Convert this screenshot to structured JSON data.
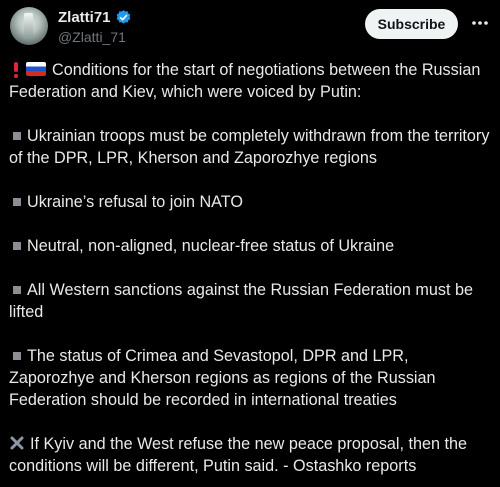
{
  "author": {
    "display_name": "Zlatti71",
    "handle": "@Zlatti_71"
  },
  "actions": {
    "subscribe_label": "Subscribe"
  },
  "post": {
    "intro": "Conditions for the start of negotiations between the Russian Federation and Kiev, which were voiced by Putin:",
    "conditions": [
      "Ukrainian troops must be completely withdrawn from the territory of the DPR, LPR, Kherson and Zaporozhye regions",
      "Ukraine’s refusal to join NATO",
      "Neutral, non-aligned, nuclear-free status of Ukraine",
      "All Western sanctions against the Russian Federation must be lifted",
      "The status of Crimea and Sevastopol, DPR and LPR, Zaporozhye and Kherson regions as regions of the Russian Federation should be recorded in international treaties"
    ],
    "closing": "If Kyiv and the West refuse the new peace proposal, then the conditions will be different, Putin said. - Ostashko reports"
  },
  "icons": {
    "verified": "verified-badge-icon",
    "more": "more-options-icon",
    "intro_marks": [
      "exclamation-icon",
      "russian-flag-icon"
    ],
    "bullet": "square-bullet-icon",
    "closing_mark": "cross-mark-icon"
  },
  "colors": {
    "background": "#000000",
    "text": "#e7e9ea",
    "secondary_text": "#71767b",
    "verified": "#1d9bf0",
    "subscribe_bg": "#eff3f4",
    "subscribe_text": "#0f1419"
  }
}
